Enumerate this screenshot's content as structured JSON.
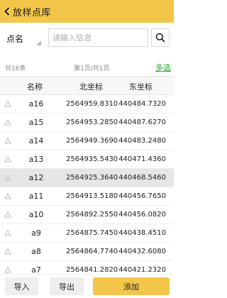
{
  "header": {
    "title": "放样点库",
    "bg_color": "#f3c64a"
  },
  "search": {
    "field": "点名",
    "placeholder": "请输入信息"
  },
  "pager": {
    "total": "共16条",
    "page": "第1页/共1页",
    "multi_select": "多选",
    "multi_color": "#2aa52a"
  },
  "table": {
    "columns": [
      "名称",
      "北坐标",
      "东坐标"
    ],
    "rows": [
      {
        "name": "a16",
        "north": "2564959.8310",
        "east": "440484.7320"
      },
      {
        "name": "a15",
        "north": "2564953.2850",
        "east": "440487.6270"
      },
      {
        "name": "a14",
        "north": "2564949.3690",
        "east": "440483.2480"
      },
      {
        "name": "a13",
        "north": "2564935.5430",
        "east": "440471.4360"
      },
      {
        "name": "a12",
        "north": "2564925.3640",
        "east": "440468.5460",
        "selected": true
      },
      {
        "name": "a11",
        "north": "2564913.5180",
        "east": "440456.7650"
      },
      {
        "name": "a10",
        "north": "2564892.2550",
        "east": "440456.0820"
      },
      {
        "name": "a9",
        "north": "2564875.7450",
        "east": "440438.4510"
      },
      {
        "name": "a8",
        "north": "2564864.7740",
        "east": "440432.6080"
      },
      {
        "name": "a7",
        "north": "2564841.2820",
        "east": "440421.2320"
      }
    ]
  },
  "footer": {
    "import_label": "导入",
    "export_label": "导出",
    "add_label": "添加"
  }
}
